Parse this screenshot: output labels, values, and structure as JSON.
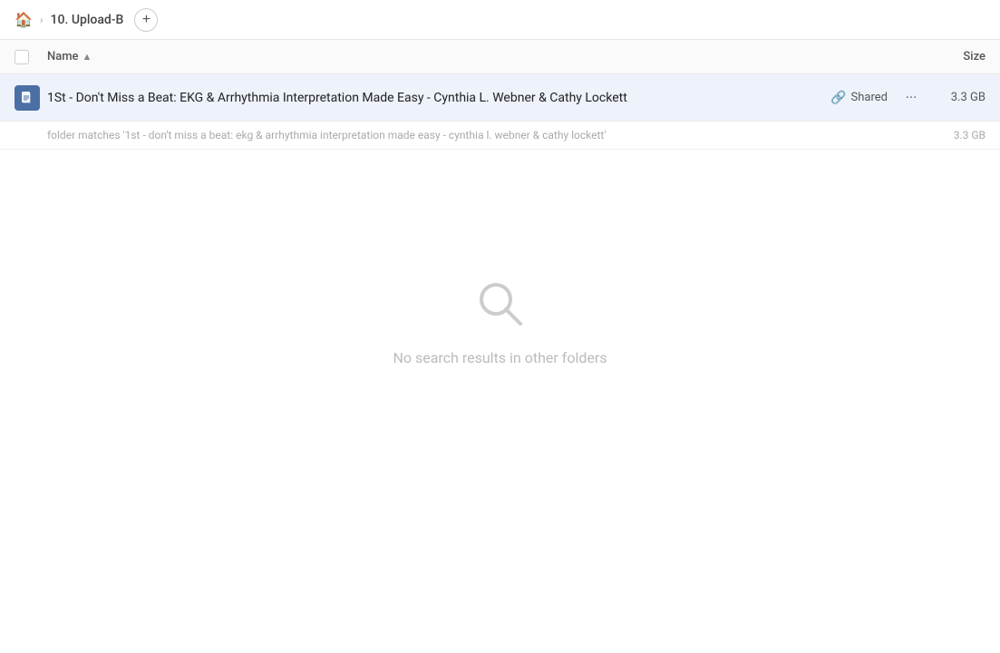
{
  "header": {
    "home_label": "home",
    "breadcrumb_separator": "›",
    "breadcrumb_item": "10. Upload-B",
    "add_tab_label": "+"
  },
  "table": {
    "name_col_label": "Name",
    "sort_indicator": "▲",
    "size_col_label": "Size"
  },
  "file_row": {
    "file_name": "1St - Don't Miss a Beat: EKG & Arrhythmia Interpretation Made Easy - Cynthia L. Webner & Cathy Lockett",
    "shared_label": "Shared",
    "more_label": "···",
    "file_size": "3.3 GB"
  },
  "subfolder_row": {
    "text": "folder matches '1st - don't miss a beat: ekg & arrhythmia interpretation made easy - cynthia l. webner & cathy lockett'",
    "size": "3.3 GB"
  },
  "empty_state": {
    "message": "No search results in other folders"
  }
}
